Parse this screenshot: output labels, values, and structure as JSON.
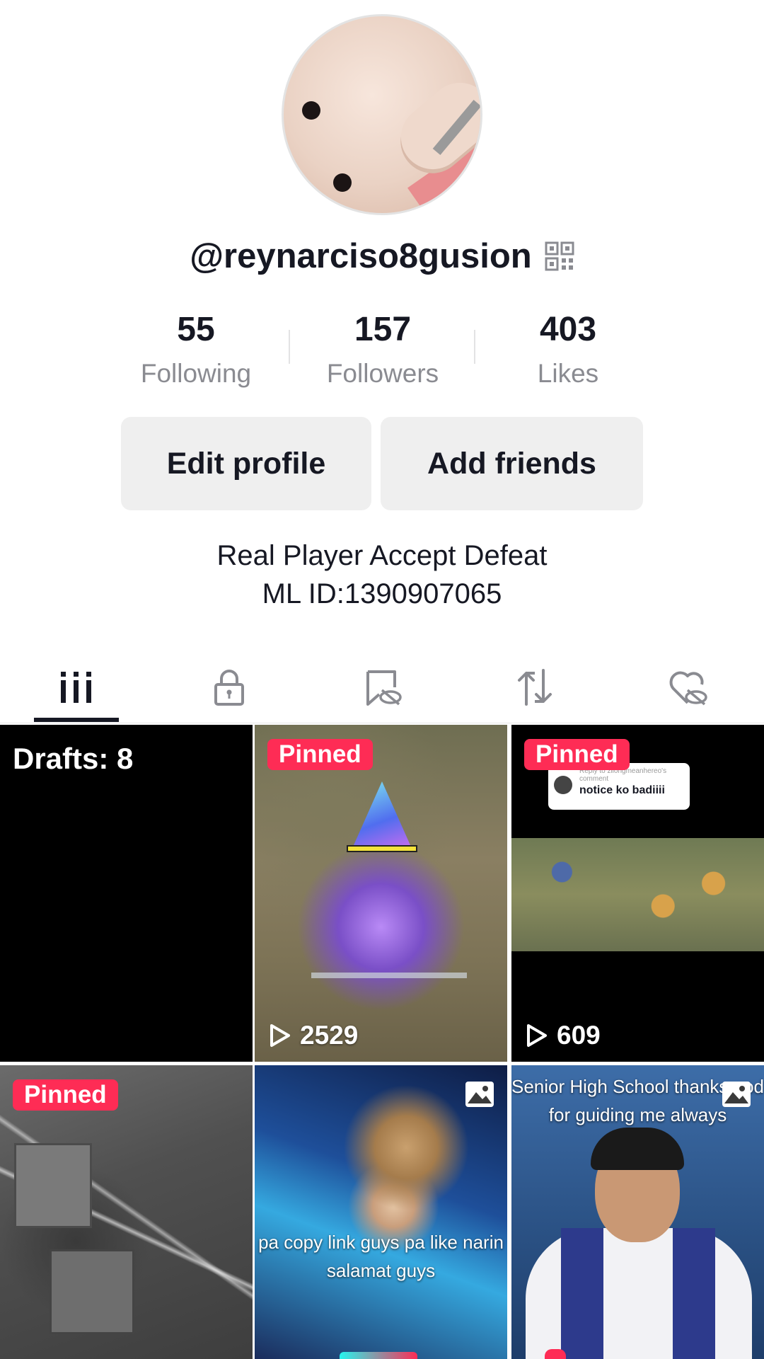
{
  "profile": {
    "username": "@reynarciso8gusion",
    "bio_line1": "Real Player Accept Defeat",
    "bio_line2": "ML ID:1390907065"
  },
  "stats": [
    {
      "value": "55",
      "label": "Following"
    },
    {
      "value": "157",
      "label": "Followers"
    },
    {
      "value": "403",
      "label": "Likes"
    }
  ],
  "buttons": {
    "edit_profile": "Edit profile",
    "add_friends": "Add friends"
  },
  "tabs": [
    {
      "icon": "grid-icon",
      "active": true
    },
    {
      "icon": "lock-icon",
      "active": false
    },
    {
      "icon": "bookmark-hidden-icon",
      "active": false
    },
    {
      "icon": "repost-icon",
      "active": false
    },
    {
      "icon": "heart-hidden-icon",
      "active": false
    }
  ],
  "grid": {
    "drafts_label": "Drafts: 8",
    "tiles": [
      {
        "pinned_label": "Pinned",
        "views": "2529"
      },
      {
        "pinned_label": "Pinned",
        "views": "609",
        "comment_small": "Reply to zilongmeanhereo's comment",
        "comment_text": "notice ko badiiii"
      },
      {
        "pinned_label": "Pinned"
      },
      {
        "caption": "pa copy link guys pa like narin salamat guys",
        "type": "photo"
      },
      {
        "caption": "Senior High School thanks god for guiding me always",
        "type": "photo"
      }
    ]
  },
  "colors": {
    "accent": "#fe2c55",
    "text": "#161823",
    "muted": "#8a8b91",
    "button_bg": "#efefef"
  }
}
